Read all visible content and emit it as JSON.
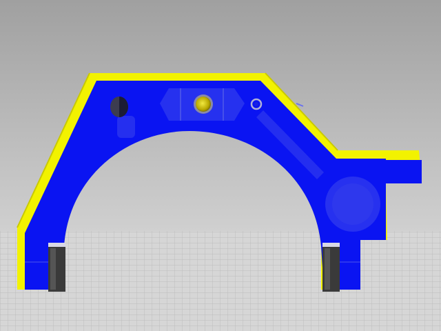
{
  "viewport": {
    "background_top": "#a4a4a4",
    "background_bottom": "#dcdcdc",
    "grid_color": "#b9b9b9",
    "floor_color": "#d9d9d9"
  },
  "part": {
    "body_color": "#0a14f2",
    "edge_color": "#f2f200",
    "edge_shadow_color": "#c8c800",
    "hole_color": "#d4cc10",
    "ghost_color": "#3a44e8",
    "foot_color": "#3a3a3a",
    "icons": [
      "bracket-part",
      "bolt-hole-icon",
      "slot-icon",
      "small-hole-icon"
    ]
  }
}
